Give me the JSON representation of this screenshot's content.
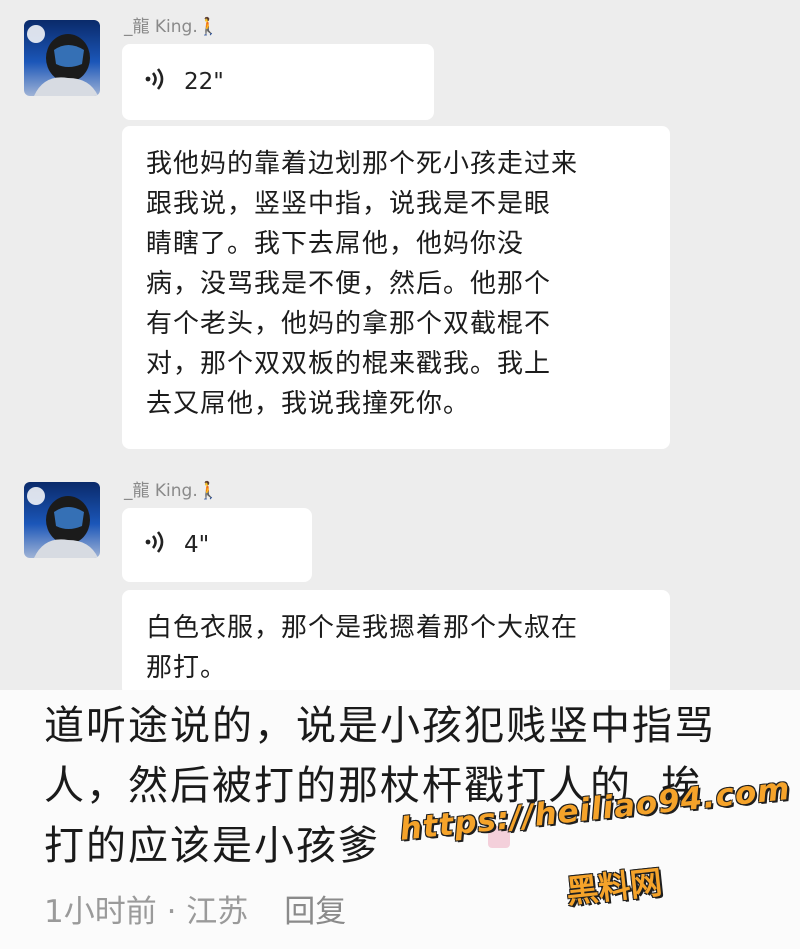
{
  "messages": [
    {
      "sender": "_龍 King.",
      "sender_emoji": "🚶",
      "voice_duration": "22\"",
      "text": "我他妈的靠着边划那个死小孩走过来\n跟我说，竖竖中指，说我是不是眼\n睛瞎了。我下去屌他，他妈你没\n病，没骂我是不便，然后。他那个\n有个老头，他妈的拿那个双截棍不\n对，那个双双板的棍来戳我。我上\n去又屌他，我说我撞死你。"
    },
    {
      "sender": "_龍 King.",
      "sender_emoji": "🚶",
      "voice_duration": "4\"",
      "text": "白色衣服，那个是我摁着那个大叔在\n那打。"
    }
  ],
  "comment": {
    "text": "道听途说的，说是小孩犯贱竖中指骂\n人，然后被打的那杖杆戳打人的  挨\n打的应该是小孩爹",
    "time_location": "1小时前 · 江苏",
    "reply_label": "回复"
  },
  "watermark": {
    "url": "https://heiliao94.com",
    "site_name": "黑料网"
  },
  "colors": {
    "chat_background": "#ededed",
    "bubble": "#ffffff",
    "watermark": "#f5a32a"
  }
}
